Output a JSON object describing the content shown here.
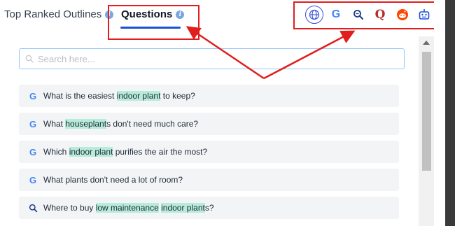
{
  "tabs": [
    {
      "label": "Top Ranked Outlines",
      "active": false
    },
    {
      "label": "Questions",
      "active": true
    }
  ],
  "source_icons": [
    "globe-icon",
    "google-icon",
    "bing-search-icon",
    "quora-icon",
    "reddit-icon",
    "bot-icon"
  ],
  "search": {
    "placeholder": "Search here..."
  },
  "questions": [
    {
      "source": "google",
      "parts": [
        "What is the easiest ",
        "indoor plant",
        " to keep?"
      ]
    },
    {
      "source": "google",
      "parts": [
        "What ",
        "houseplant",
        "s don't need much care?"
      ]
    },
    {
      "source": "google",
      "parts": [
        "Which ",
        "indoor plant",
        " purifies the air the most?"
      ]
    },
    {
      "source": "google",
      "parts": [
        "What plants don't need a lot of room?"
      ]
    },
    {
      "source": "search",
      "parts": [
        "Where to buy ",
        "low maintenance",
        " ",
        "indoor plant",
        "s?"
      ]
    }
  ],
  "colors": {
    "accent": "#1d4ed8",
    "highlight": "#b7ecd9",
    "annotation": "#e11d1d"
  }
}
